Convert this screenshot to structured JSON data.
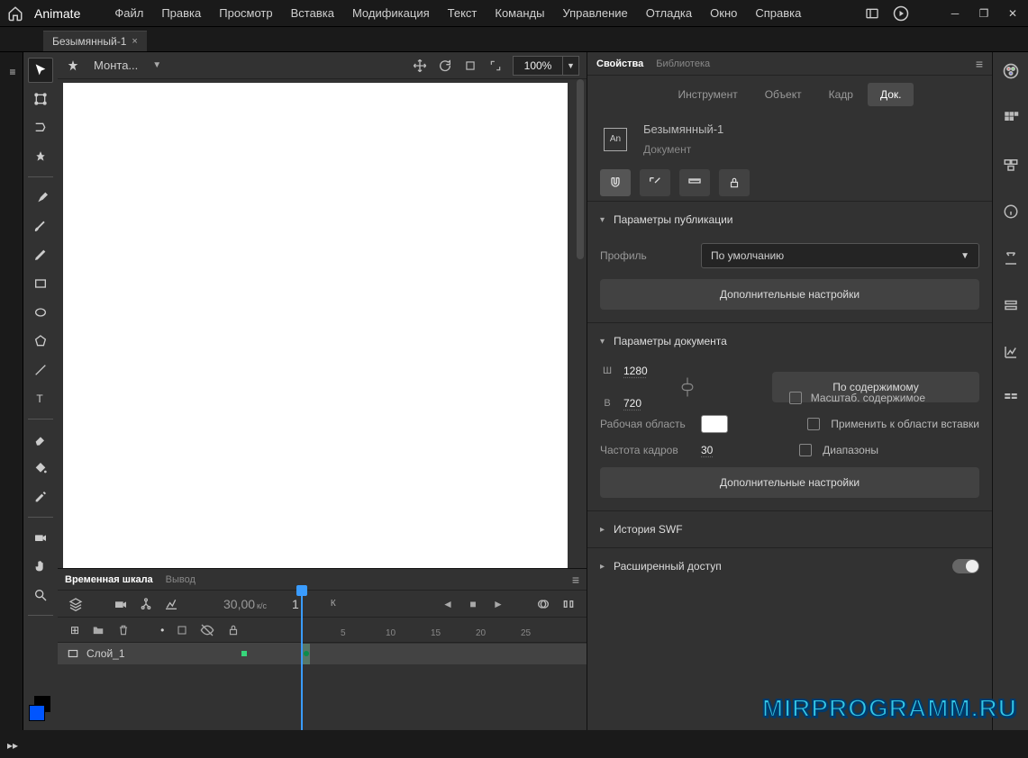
{
  "app": {
    "name": "Animate"
  },
  "menu": {
    "items": [
      "Файл",
      "Правка",
      "Просмотр",
      "Вставка",
      "Модификация",
      "Текст",
      "Команды",
      "Управление",
      "Отладка",
      "Окно",
      "Справка"
    ]
  },
  "document_tab": {
    "title": "Безымянный-1"
  },
  "stage": {
    "scene_label": "Монта...",
    "zoom": "100%"
  },
  "timeline": {
    "tab_active": "Временная шкала",
    "tab_secondary": "Вывод",
    "fps_value": "30,00",
    "fps_unit": "к/с",
    "current_frame": "1",
    "frame_indicator": "К",
    "ruler_ticks": [
      "5",
      "10",
      "15",
      "20",
      "25",
      ""
    ],
    "layer_name": "Слой_1"
  },
  "properties": {
    "panel_tabs": {
      "active": "Свойства",
      "secondary": "Библиотека"
    },
    "subtabs": [
      "Инструмент",
      "Объект",
      "Кадр",
      "Док."
    ],
    "subtab_active_index": 3,
    "an_badge": "An",
    "doc_title": "Безымянный-1",
    "doc_sub": "Документ",
    "publish": {
      "section_title": "Параметры публикации",
      "profile_label": "Профиль",
      "profile_value": "По умолчанию",
      "extra_btn": "Дополнительные настройки"
    },
    "doc_params": {
      "section_title": "Параметры документа",
      "w_label": "Ш",
      "w_value": "1280",
      "h_label": "В",
      "h_value": "720",
      "fit_btn": "По содержимому",
      "stage_area_label": "Рабочая область",
      "stage_color": "#ffffff",
      "framerate_label": "Частота кадров",
      "framerate_value": "30",
      "scale_label": "Масштаб. содержимое",
      "apply_label": "Применить к области вставки",
      "range_label": "Диапазоны",
      "extra_btn": "Дополнительные настройки"
    },
    "swf_history": "История SWF",
    "accessibility": "Расширенный доступ"
  },
  "watermark": "MIRPROGRAMM.RU"
}
